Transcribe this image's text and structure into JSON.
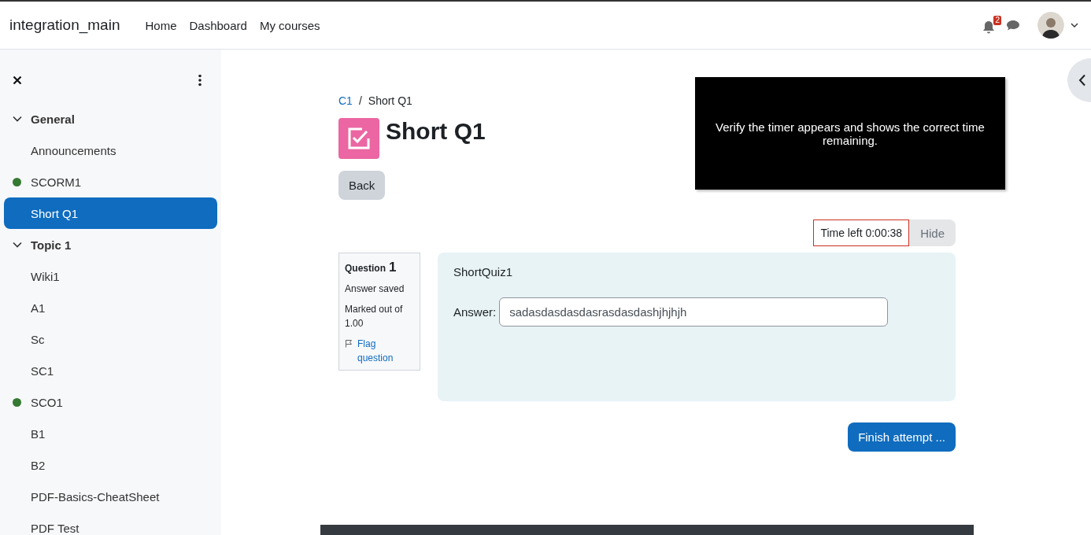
{
  "navbar": {
    "site_name": "integration_main",
    "links": [
      "Home",
      "Dashboard",
      "My courses"
    ],
    "notification_count": "2"
  },
  "sidebar": {
    "items": [
      {
        "kind": "section",
        "label": "General",
        "expanded": true,
        "selected": false
      },
      {
        "kind": "item",
        "label": "Announcements",
        "selected": false
      },
      {
        "kind": "item",
        "label": "SCORM1",
        "selected": false,
        "color": "#357a32"
      },
      {
        "kind": "item",
        "label": "Short Q1",
        "selected": true
      },
      {
        "kind": "section",
        "label": "Topic 1",
        "expanded": true,
        "selected": false
      },
      {
        "kind": "item",
        "label": "Wiki1",
        "selected": false
      },
      {
        "kind": "item",
        "label": "A1",
        "selected": false
      },
      {
        "kind": "item",
        "label": "Sc",
        "selected": false
      },
      {
        "kind": "item",
        "label": "SC1",
        "selected": false
      },
      {
        "kind": "item",
        "label": "SCO1",
        "selected": false,
        "color": "#357a32"
      },
      {
        "kind": "item",
        "label": "B1",
        "selected": false
      },
      {
        "kind": "item",
        "label": "B2",
        "selected": false
      },
      {
        "kind": "item",
        "label": "PDF-Basics-CheatSheet",
        "selected": false
      },
      {
        "kind": "item",
        "label": "PDF Test",
        "selected": false
      }
    ]
  },
  "breadcrumb": {
    "separator": "/",
    "items": [
      {
        "kind": "link",
        "label": "C1"
      },
      {
        "kind": "current",
        "label": "Short Q1"
      }
    ]
  },
  "page_title": "Short Q1",
  "back_button": "Back",
  "overlay_note": "Verify the timer appears and shows the correct time remaining.",
  "timer": {
    "text": "Time left 0:00:38",
    "hide_button": "Hide"
  },
  "question_info": {
    "label": "Question",
    "number": "1",
    "state": "Answer saved",
    "marks": "Marked out of 1.00",
    "flag_link": "Flag question"
  },
  "question": {
    "text": "ShortQuiz1",
    "answer_label": "Answer:",
    "answer_value": "sadasdasdasdasrasdasdashjhjhjh"
  },
  "finish_button": "Finish attempt ..."
}
